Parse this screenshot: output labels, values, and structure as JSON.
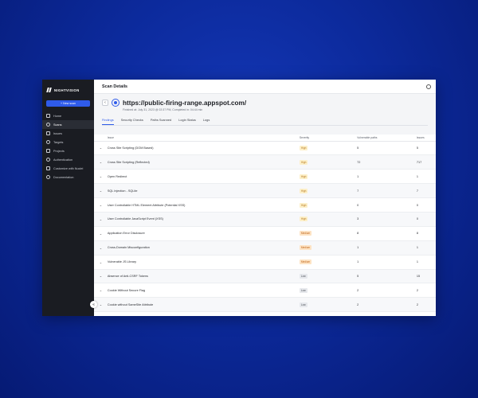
{
  "sidebar": {
    "logo": "NIGHTVISION",
    "new_scan": "+ New scan",
    "items": [
      {
        "label": "Home",
        "icon": "home-icon"
      },
      {
        "label": "Scans",
        "icon": "scans-icon",
        "active": true
      },
      {
        "label": "Issues",
        "icon": "issues-icon"
      },
      {
        "label": "Targets",
        "icon": "targets-icon"
      },
      {
        "label": "Projects",
        "icon": "projects-icon"
      },
      {
        "label": "Authentication",
        "icon": "auth-icon"
      },
      {
        "label": "Customize with Nuclei",
        "icon": "nuclei-icon"
      },
      {
        "label": "Documentation",
        "icon": "docs-icon"
      }
    ],
    "collapse_glyph": "«"
  },
  "header": {
    "title": "Scan Details",
    "back_glyph": "‹",
    "target_url": "https://public-firing-range.appspot.com/",
    "meta": "Finished at: July 31, 2023 @ 02:37 PM, Completed in: 04:44 min"
  },
  "tabs": [
    {
      "label": "Findings",
      "active": true
    },
    {
      "label": "Security Checks"
    },
    {
      "label": "Paths Scanned"
    },
    {
      "label": "Login Status"
    },
    {
      "label": "Logs"
    }
  ],
  "table": {
    "columns": [
      "Issue",
      "Severity",
      "Vulnerable paths",
      "Issues"
    ],
    "rows": [
      {
        "issue": "Cross Site Scripting (DOM Based)",
        "severity": "High",
        "paths": "5",
        "issues": "5"
      },
      {
        "issue": "Cross Site Scripting (Reflected)",
        "severity": "High",
        "paths": "72",
        "issues": "717"
      },
      {
        "issue": "Open Redirect",
        "severity": "High",
        "paths": "1",
        "issues": "1"
      },
      {
        "issue": "SQL Injection - SQLite",
        "severity": "High",
        "paths": "7",
        "issues": "7"
      },
      {
        "issue": "User Controllable HTML Element Attribute (Potential XSS)",
        "severity": "High",
        "paths": "0",
        "issues": "0"
      },
      {
        "issue": "User Controllable JavaScript Event (XSS)",
        "severity": "High",
        "paths": "3",
        "issues": "0"
      },
      {
        "issue": "Application Error Disclosure",
        "severity": "Medium",
        "paths": "8",
        "issues": "8"
      },
      {
        "issue": "Cross-Domain Misconfiguration",
        "severity": "Medium",
        "paths": "1",
        "issues": "1"
      },
      {
        "issue": "Vulnerable JS Library",
        "severity": "Medium",
        "paths": "1",
        "issues": "1"
      },
      {
        "issue": "Absence of Anti-CSRF Tokens",
        "severity": "Low",
        "paths": "5",
        "issues": "15"
      },
      {
        "issue": "Cookie Without Secure Flag",
        "severity": "Low",
        "paths": "2",
        "issues": "2"
      },
      {
        "issue": "Cookie without SameSite Attribute",
        "severity": "Low",
        "paths": "2",
        "issues": "2"
      }
    ]
  },
  "severity_colors": {
    "High": {
      "bg": "#fdf0c9",
      "fg": "#b7791f"
    },
    "Medium": {
      "bg": "#fde3c4",
      "fg": "#c0661a"
    },
    "Low": {
      "bg": "#e6e8ec",
      "fg": "#4a4f58"
    }
  },
  "accent": "#2f5bea"
}
